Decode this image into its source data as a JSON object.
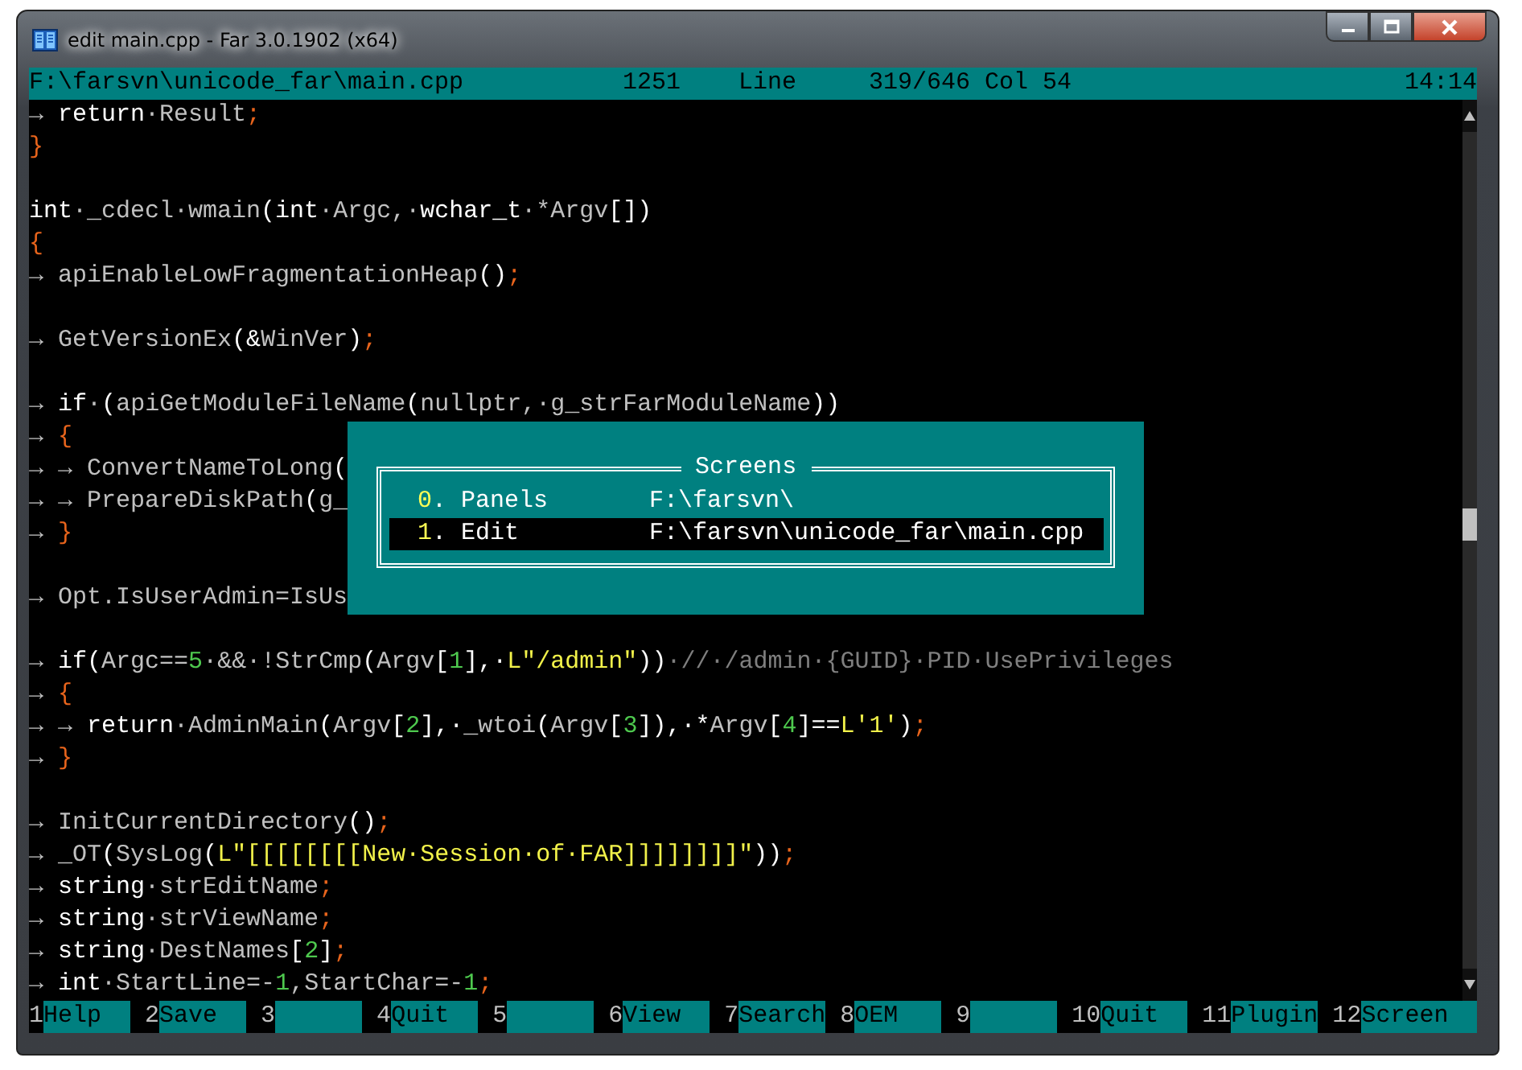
{
  "window": {
    "title": "edit main.cpp - Far 3.0.1902 (x64)"
  },
  "status": {
    "file": "F:\\farsvn\\unicode_far\\main.cpp",
    "codepage": "1251",
    "line_label": "Line",
    "position": "319/646",
    "column": "Col 54",
    "clock": "14:14"
  },
  "lines": [
    {
      "kind": "code",
      "tokens": [
        {
          "kind": "tab",
          "text": "→ "
        },
        {
          "kind": "kw",
          "text": "return"
        },
        {
          "kind": "id",
          "text": "·Result"
        },
        {
          "kind": "p",
          "text": ";"
        }
      ]
    },
    {
      "kind": "code",
      "tokens": [
        {
          "kind": "p",
          "text": "}"
        }
      ]
    },
    {
      "kind": "blank"
    },
    {
      "kind": "code",
      "tokens": [
        {
          "kind": "kw",
          "text": "int"
        },
        {
          "kind": "id",
          "text": "·_cdecl·wmain"
        },
        {
          "kind": "kw",
          "text": "(int"
        },
        {
          "kind": "id",
          "text": "·Argc,·"
        },
        {
          "kind": "kw",
          "text": "wchar_t"
        },
        {
          "kind": "id",
          "text": "·*Argv"
        },
        {
          "kind": "kw",
          "text": "[])"
        }
      ]
    },
    {
      "kind": "code",
      "tokens": [
        {
          "kind": "p",
          "text": "{"
        }
      ]
    },
    {
      "kind": "code",
      "tokens": [
        {
          "kind": "tab",
          "text": "→ "
        },
        {
          "kind": "id",
          "text": "apiEnableLowFragmentationHeap"
        },
        {
          "kind": "kw",
          "text": "()"
        },
        {
          "kind": "p",
          "text": ";"
        }
      ]
    },
    {
      "kind": "blank"
    },
    {
      "kind": "code",
      "tokens": [
        {
          "kind": "tab",
          "text": "→ "
        },
        {
          "kind": "id",
          "text": "GetVersionEx"
        },
        {
          "kind": "kw",
          "text": "(&"
        },
        {
          "kind": "id",
          "text": "WinVer"
        },
        {
          "kind": "kw",
          "text": ")"
        },
        {
          "kind": "p",
          "text": ";"
        }
      ]
    },
    {
      "kind": "blank"
    },
    {
      "kind": "code",
      "tokens": [
        {
          "kind": "tab",
          "text": "→ "
        },
        {
          "kind": "kw",
          "text": "if"
        },
        {
          "kind": "id",
          "text": "·"
        },
        {
          "kind": "kw",
          "text": "("
        },
        {
          "kind": "id",
          "text": "apiGetModuleFileName"
        },
        {
          "kind": "kw",
          "text": "("
        },
        {
          "kind": "id",
          "text": "nullptr,·g_strFarModuleName"
        },
        {
          "kind": "kw",
          "text": "))"
        }
      ]
    },
    {
      "kind": "code",
      "tokens": [
        {
          "kind": "tab",
          "text": "→ "
        },
        {
          "kind": "p",
          "text": "{"
        }
      ]
    },
    {
      "kind": "code",
      "tokens": [
        {
          "kind": "tab",
          "text": "→ → "
        },
        {
          "kind": "id",
          "text": "ConvertNameToLong"
        },
        {
          "kind": "kw",
          "text": "("
        }
      ]
    },
    {
      "kind": "code",
      "tokens": [
        {
          "kind": "tab",
          "text": "→ → "
        },
        {
          "kind": "id",
          "text": "PrepareDiskPath"
        },
        {
          "kind": "kw",
          "text": "("
        },
        {
          "kind": "id",
          "text": "g_"
        }
      ]
    },
    {
      "kind": "code",
      "tokens": [
        {
          "kind": "tab",
          "text": "→ "
        },
        {
          "kind": "p",
          "text": "}"
        }
      ]
    },
    {
      "kind": "blank"
    },
    {
      "kind": "code",
      "tokens": [
        {
          "kind": "tab",
          "text": "→ "
        },
        {
          "kind": "id",
          "text": "Opt.IsUserAdmin=IsUs"
        }
      ]
    },
    {
      "kind": "blank"
    },
    {
      "kind": "code",
      "tokens": [
        {
          "kind": "tab",
          "text": "→ "
        },
        {
          "kind": "kw",
          "text": "if("
        },
        {
          "kind": "id",
          "text": "Argc=="
        },
        {
          "kind": "n",
          "text": "5"
        },
        {
          "kind": "id",
          "text": "·&&·!StrCmp"
        },
        {
          "kind": "kw",
          "text": "("
        },
        {
          "kind": "id",
          "text": "Argv"
        },
        {
          "kind": "kw",
          "text": "["
        },
        {
          "kind": "n",
          "text": "1"
        },
        {
          "kind": "kw",
          "text": "],·"
        },
        {
          "kind": "s",
          "text": "L\"/admin\""
        },
        {
          "kind": "kw",
          "text": "))"
        },
        {
          "kind": "c",
          "text": "·//·/admin·{GUID}·PID·UsePrivileges"
        }
      ]
    },
    {
      "kind": "code",
      "tokens": [
        {
          "kind": "tab",
          "text": "→ "
        },
        {
          "kind": "p",
          "text": "{"
        }
      ]
    },
    {
      "kind": "code",
      "tokens": [
        {
          "kind": "tab",
          "text": "→ → "
        },
        {
          "kind": "kw",
          "text": "return"
        },
        {
          "kind": "id",
          "text": "·AdminMain"
        },
        {
          "kind": "kw",
          "text": "("
        },
        {
          "kind": "id",
          "text": "Argv"
        },
        {
          "kind": "kw",
          "text": "["
        },
        {
          "kind": "n",
          "text": "2"
        },
        {
          "kind": "kw",
          "text": "],·"
        },
        {
          "kind": "id",
          "text": "_wtoi"
        },
        {
          "kind": "kw",
          "text": "("
        },
        {
          "kind": "id",
          "text": "Argv"
        },
        {
          "kind": "kw",
          "text": "["
        },
        {
          "kind": "n",
          "text": "3"
        },
        {
          "kind": "kw",
          "text": "]),·*"
        },
        {
          "kind": "id",
          "text": "Argv"
        },
        {
          "kind": "kw",
          "text": "["
        },
        {
          "kind": "n",
          "text": "4"
        },
        {
          "kind": "kw",
          "text": "]=="
        },
        {
          "kind": "s",
          "text": "L'1'"
        },
        {
          "kind": "kw",
          "text": ")"
        },
        {
          "kind": "p",
          "text": ";"
        }
      ]
    },
    {
      "kind": "code",
      "tokens": [
        {
          "kind": "tab",
          "text": "→ "
        },
        {
          "kind": "p",
          "text": "}"
        }
      ]
    },
    {
      "kind": "blank"
    },
    {
      "kind": "code",
      "tokens": [
        {
          "kind": "tab",
          "text": "→ "
        },
        {
          "kind": "id",
          "text": "InitCurrentDirectory"
        },
        {
          "kind": "kw",
          "text": "()"
        },
        {
          "kind": "p",
          "text": ";"
        }
      ]
    },
    {
      "kind": "code",
      "tokens": [
        {
          "kind": "tab",
          "text": "→ "
        },
        {
          "kind": "id",
          "text": "_OT"
        },
        {
          "kind": "kw",
          "text": "("
        },
        {
          "kind": "id",
          "text": "SysLog"
        },
        {
          "kind": "kw",
          "text": "("
        },
        {
          "kind": "s",
          "text": "L\"[[[[[[[[New·Session·of·FAR]]]]]]]]\""
        },
        {
          "kind": "kw",
          "text": "))"
        },
        {
          "kind": "p",
          "text": ";"
        }
      ]
    },
    {
      "kind": "code",
      "tokens": [
        {
          "kind": "tab",
          "text": "→ "
        },
        {
          "kind": "kw",
          "text": "string"
        },
        {
          "kind": "id",
          "text": "·strEditName"
        },
        {
          "kind": "p",
          "text": ";"
        }
      ]
    },
    {
      "kind": "code",
      "tokens": [
        {
          "kind": "tab",
          "text": "→ "
        },
        {
          "kind": "kw",
          "text": "string"
        },
        {
          "kind": "id",
          "text": "·strViewName"
        },
        {
          "kind": "p",
          "text": ";"
        }
      ]
    },
    {
      "kind": "code",
      "tokens": [
        {
          "kind": "tab",
          "text": "→ "
        },
        {
          "kind": "kw",
          "text": "string"
        },
        {
          "kind": "id",
          "text": "·DestNames"
        },
        {
          "kind": "kw",
          "text": "["
        },
        {
          "kind": "n",
          "text": "2"
        },
        {
          "kind": "kw",
          "text": "]"
        },
        {
          "kind": "p",
          "text": ";"
        }
      ]
    },
    {
      "kind": "code",
      "tokens": [
        {
          "kind": "tab",
          "text": "→ "
        },
        {
          "kind": "kw",
          "text": "int"
        },
        {
          "kind": "id",
          "text": "·StartLine=-"
        },
        {
          "kind": "n",
          "text": "1"
        },
        {
          "kind": "id",
          "text": ",StartChar=-"
        },
        {
          "kind": "n",
          "text": "1"
        },
        {
          "kind": "p",
          "text": ";"
        }
      ]
    }
  ],
  "dialog": {
    "title": "Screens",
    "items": [
      {
        "hotkey": "0",
        "label": ". Panels",
        "path": "F:\\farsvn\\",
        "selected": false
      },
      {
        "hotkey": "1",
        "label": ". Edit",
        "path": "F:\\farsvn\\unicode_far\\main.cpp",
        "selected": true
      }
    ]
  },
  "keybar": [
    {
      "key": "1",
      "label": "Help"
    },
    {
      "key": "2",
      "label": "Save"
    },
    {
      "key": "3"
    },
    {
      "key": "4",
      "label": "Quit"
    },
    {
      "key": "5"
    },
    {
      "key": "6",
      "label": "View"
    },
    {
      "key": "7",
      "label": "Search"
    },
    {
      "key": "8",
      "label": "OEM"
    },
    {
      "key": "9"
    },
    {
      "key": "10",
      "label": "Quit"
    },
    {
      "key": "11",
      "label": "Plugin"
    },
    {
      "key": "12",
      "label": "Screen"
    }
  ]
}
